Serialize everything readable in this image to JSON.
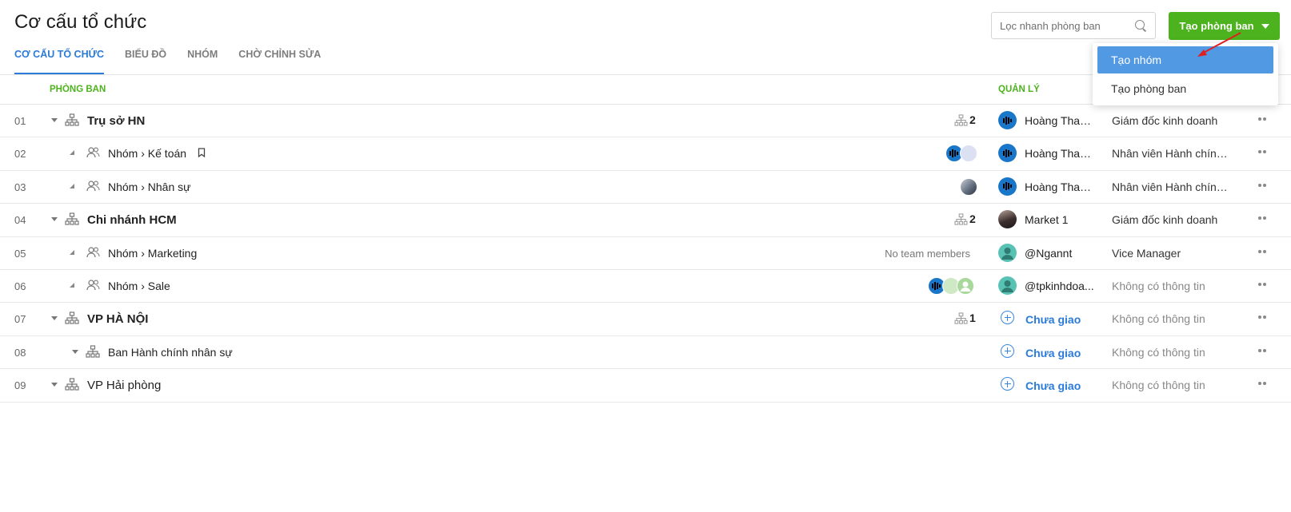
{
  "page": {
    "title": "Cơ cấu tổ chức"
  },
  "tabs": [
    {
      "label": "CƠ CẤU TỔ CHỨC",
      "active": true
    },
    {
      "label": "BIỂU ĐỒ",
      "active": false
    },
    {
      "label": "NHÓM",
      "active": false
    },
    {
      "label": "CHỜ CHỈNH SỬA",
      "active": false
    }
  ],
  "search": {
    "placeholder": "Lọc nhanh phòng ban",
    "value": ""
  },
  "create_button": {
    "label": "Tạo phòng ban",
    "color": "#4cb21d"
  },
  "dropdown": {
    "items": [
      {
        "label": "Tạo nhóm",
        "selected": true
      },
      {
        "label": "Tạo phòng ban",
        "selected": false
      }
    ]
  },
  "table": {
    "headers": {
      "department": "PHÒNG BAN",
      "manager": "QUẢN LÝ"
    },
    "rows": [
      {
        "num": "01",
        "name": "Trụ sở HN",
        "type": "department",
        "sub_count": "2",
        "manager": "Hoàng Thanh...",
        "position": "Giám đốc kinh doanh"
      },
      {
        "num": "02",
        "name": "Nhóm › Kế toán",
        "type": "team",
        "manager": "Hoàng Thanh...",
        "position": "Nhân viên Hành chính..."
      },
      {
        "num": "03",
        "name": "Nhóm › Nhân sự",
        "type": "team",
        "manager": "Hoàng Thanh...",
        "position": "Nhân viên Hành chính..."
      },
      {
        "num": "04",
        "name": "Chi nhánh HCM",
        "type": "department",
        "sub_count": "2",
        "manager": "Market 1",
        "position": "Giám đốc kinh doanh"
      },
      {
        "num": "05",
        "name": "Nhóm › Marketing",
        "type": "team",
        "no_members": "No team members",
        "manager": "@Ngannt",
        "position": "Vice Manager"
      },
      {
        "num": "06",
        "name": "Nhóm › Sale",
        "type": "team",
        "manager": "@tpkinhdoa...",
        "position": "Không có thông tin"
      },
      {
        "num": "07",
        "name": "VP HÀ NỘI",
        "type": "department",
        "sub_count": "1",
        "manager": "Chưa giao",
        "position": "Không có thông tin"
      },
      {
        "num": "08",
        "name": "Ban Hành chính nhân sự",
        "type": "subdepartment",
        "manager": "Chưa giao",
        "position": "Không có thông tin"
      },
      {
        "num": "09",
        "name": "VP Hải phòng",
        "type": "department",
        "manager": "Chưa giao",
        "position": "Không có thông tin"
      }
    ]
  }
}
